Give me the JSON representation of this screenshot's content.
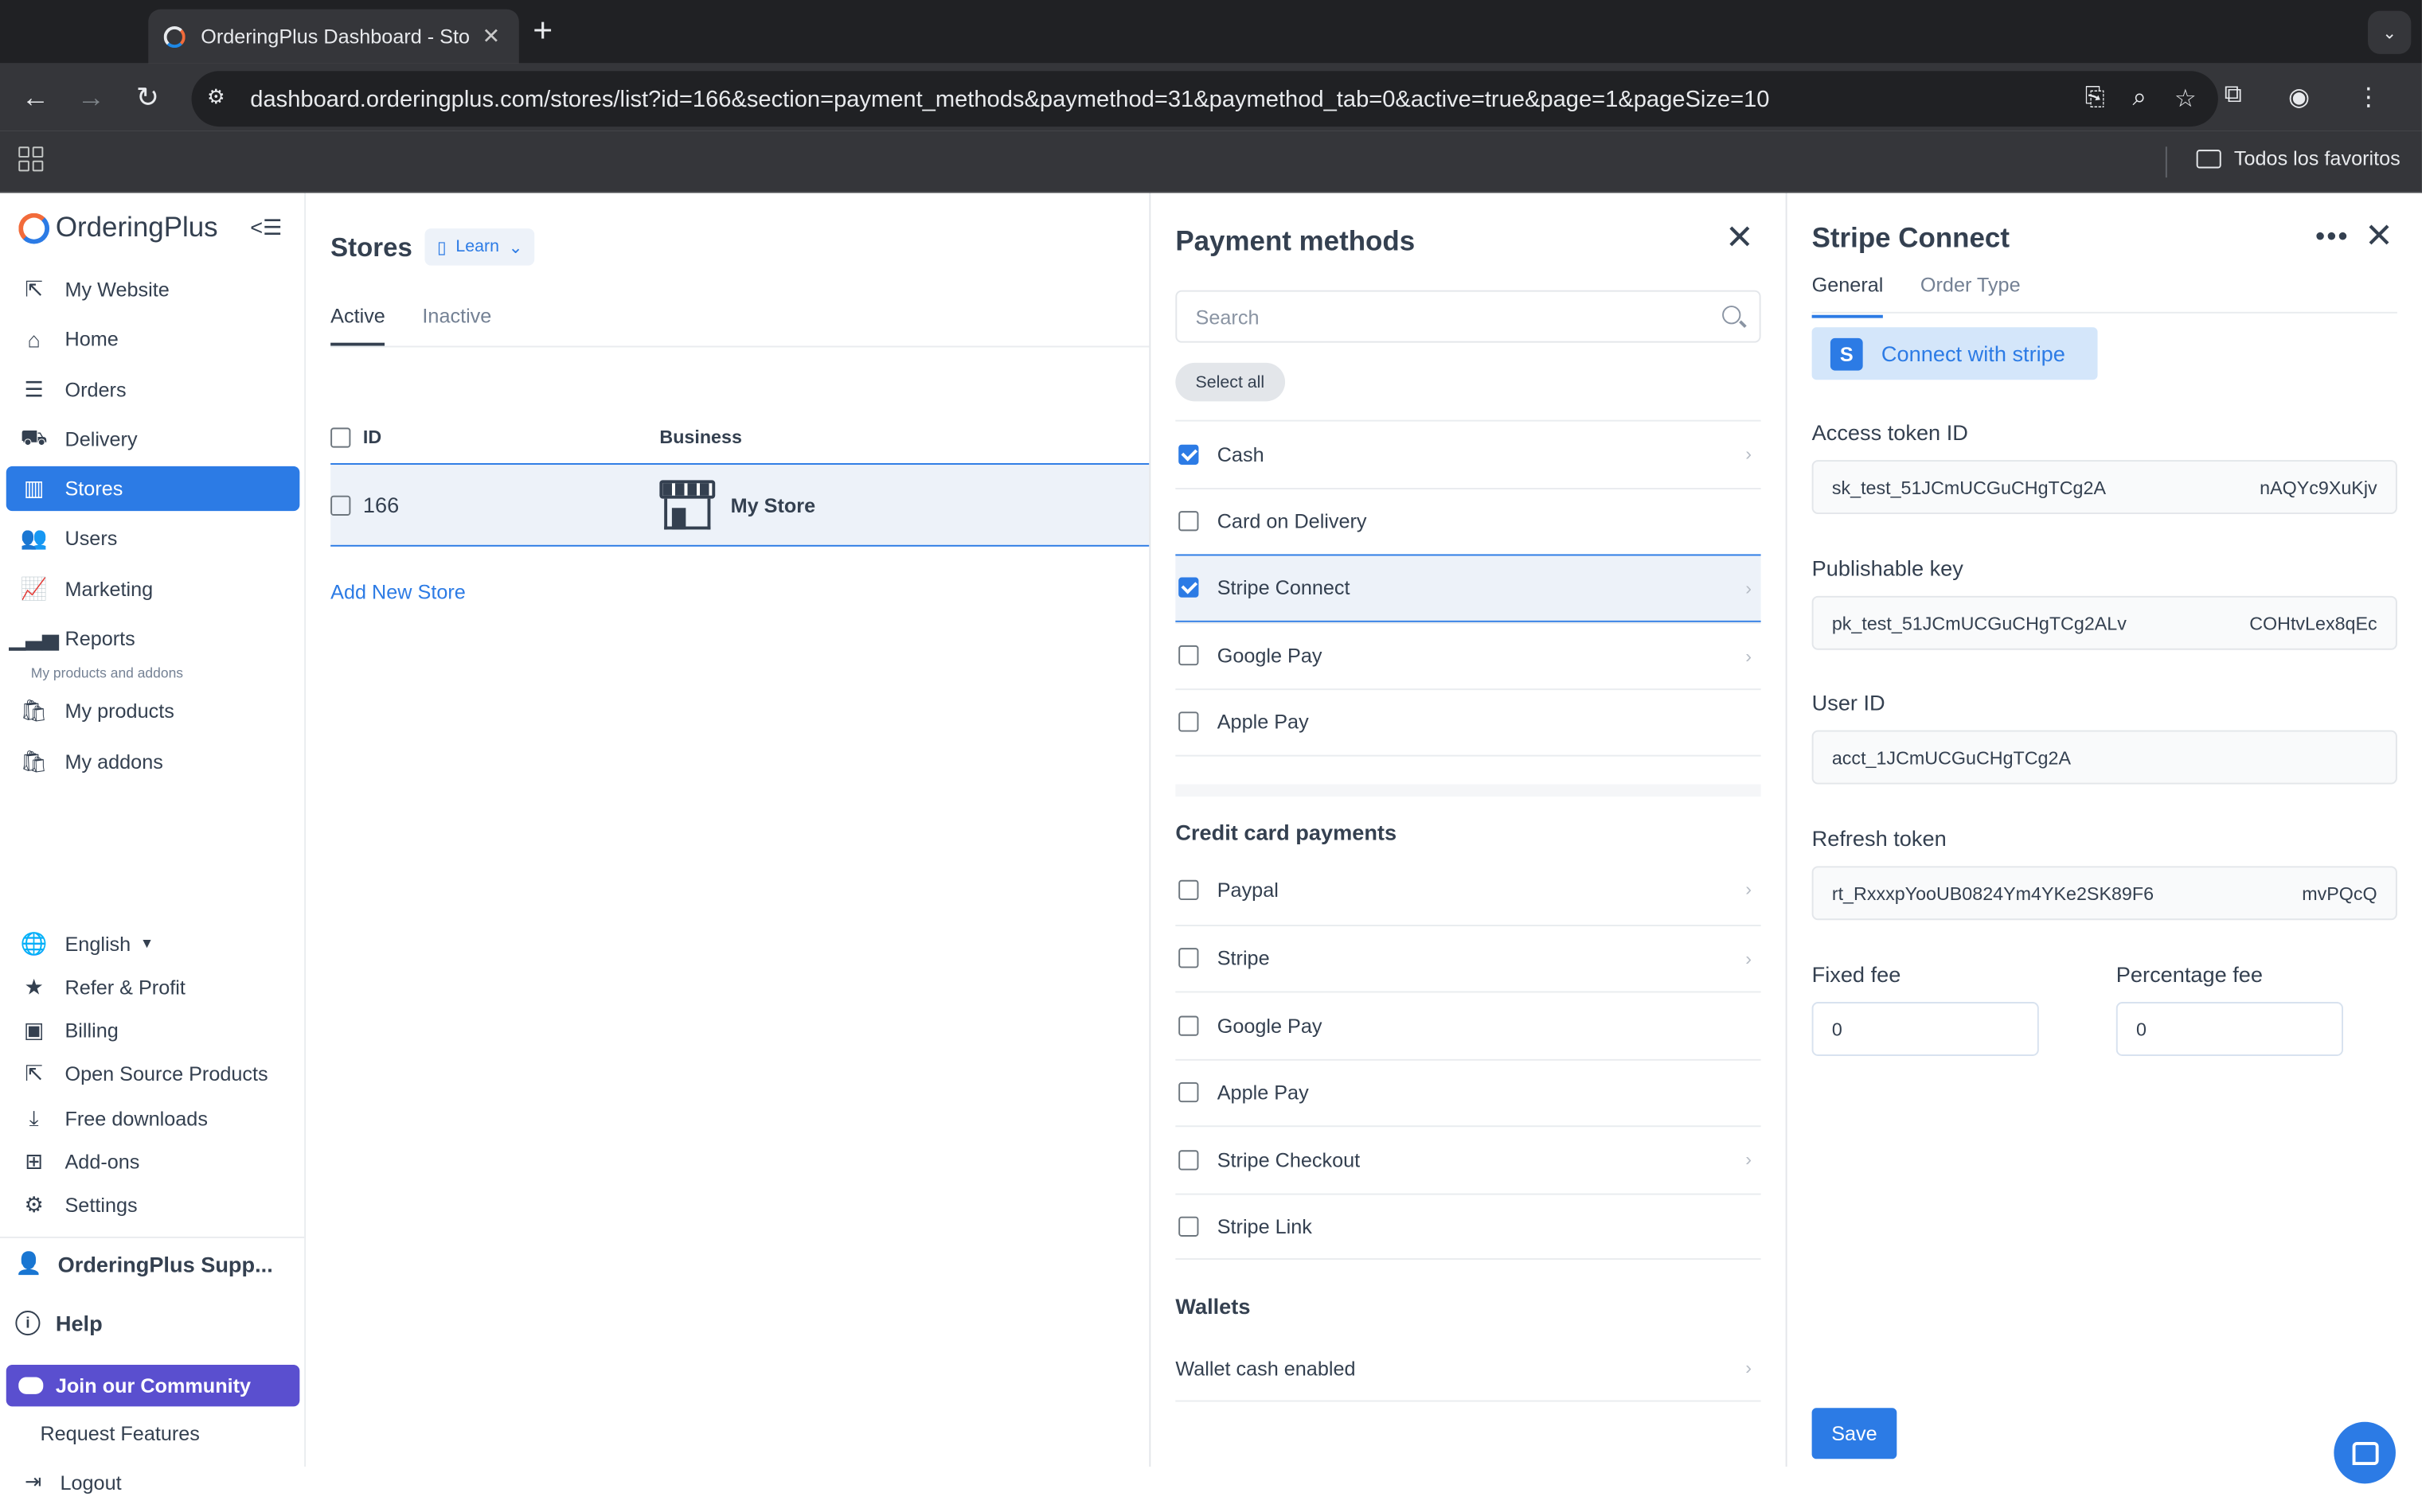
{
  "browser": {
    "tab_title": "OrderingPlus Dashboard - Sto",
    "tab_close": "✕",
    "new_tab": "+",
    "url": "dashboard.orderingplus.com/stores/list?id=166&section=payment_methods&paymethod=31&paymethod_tab=0&active=true&page=1&pageSize=10",
    "bookmarks_all": "Todos los favoritos"
  },
  "sidebar": {
    "brand_main": "Ordering",
    "brand_plus": "Plus",
    "items": [
      {
        "label": "My Website",
        "icon": "external-link-icon"
      },
      {
        "label": "Home",
        "icon": "home-icon"
      },
      {
        "label": "Orders",
        "icon": "list-icon"
      },
      {
        "label": "Delivery",
        "icon": "truck-icon"
      },
      {
        "label": "Stores",
        "icon": "store-icon",
        "active": true
      },
      {
        "label": "Users",
        "icon": "users-icon"
      },
      {
        "label": "Marketing",
        "icon": "chart-line-icon"
      },
      {
        "label": "Reports",
        "icon": "bar-chart-icon"
      }
    ],
    "products_caption": "My products and addons",
    "product_items": [
      {
        "label": "My products",
        "icon": "bag-check-icon"
      },
      {
        "label": "My addons",
        "icon": "bag-heart-icon"
      }
    ],
    "language": "English",
    "bottom_items": [
      {
        "label": "Refer & Profit",
        "icon": "star-icon"
      },
      {
        "label": "Billing",
        "icon": "cash-icon"
      },
      {
        "label": "Open Source Products",
        "icon": "external-link-icon"
      },
      {
        "label": "Free downloads",
        "icon": "download-icon"
      },
      {
        "label": "Add-ons",
        "icon": "bag-plus-icon"
      },
      {
        "label": "Settings",
        "icon": "gear-icon"
      }
    ],
    "support": "OrderingPlus Supp...",
    "help": "Help",
    "community": "Join our Community",
    "request_features": "Request Features",
    "logout": "Logout"
  },
  "stores": {
    "title": "Stores",
    "learn": "Learn",
    "tabs": [
      "Active",
      "Inactive"
    ],
    "columns": {
      "id": "ID",
      "business": "Business"
    },
    "rows": [
      {
        "id": "166",
        "name": "My Store"
      }
    ],
    "add_new": "Add New Store"
  },
  "payment_methods": {
    "title": "Payment methods",
    "search_placeholder": "Search",
    "select_all": "Select all",
    "items": [
      {
        "label": "Cash",
        "checked": true,
        "chevron": true
      },
      {
        "label": "Card on Delivery",
        "checked": false,
        "chevron": false
      },
      {
        "label": "Stripe Connect",
        "checked": true,
        "chevron": true,
        "selected": true
      },
      {
        "label": "Google Pay",
        "checked": false,
        "chevron": true
      },
      {
        "label": "Apple Pay",
        "checked": false,
        "chevron": false
      }
    ],
    "credit_title": "Credit card payments",
    "credit_items": [
      {
        "label": "Paypal",
        "checked": false,
        "chevron": true
      },
      {
        "label": "Stripe",
        "checked": false,
        "chevron": true
      },
      {
        "label": "Google Pay",
        "checked": false,
        "chevron": false
      },
      {
        "label": "Apple Pay",
        "checked": false,
        "chevron": false
      },
      {
        "label": "Stripe Checkout",
        "checked": false,
        "chevron": true
      },
      {
        "label": "Stripe Link",
        "checked": false,
        "chevron": false
      }
    ],
    "wallets_title": "Wallets",
    "wallet_item": "Wallet cash enabled"
  },
  "stripe_connect": {
    "title": "Stripe Connect",
    "tabs": [
      "General",
      "Order Type"
    ],
    "connect_button": "Connect with stripe",
    "access_token_label": "Access token ID",
    "access_token_start": "sk_test_51JCmUCGuCHgTCg2A",
    "access_token_end": "nAQYc9XuKjv",
    "publishable_key_label": "Publishable key",
    "publishable_key_start": "pk_test_51JCmUCGuCHgTCg2ALv",
    "publishable_key_end": "COHtvLex8qEc",
    "user_id_label": "User ID",
    "user_id": "acct_1JCmUCGuCHgTCg2A",
    "refresh_token_label": "Refresh token",
    "refresh_token_start": "rt_RxxxpYooUB0824Ym4YKe2SK89F6",
    "refresh_token_end": "mvPQcQ",
    "fixed_fee_label": "Fixed fee",
    "fixed_fee": "0",
    "percentage_fee_label": "Percentage fee",
    "percentage_fee": "0",
    "save": "Save"
  },
  "colors": {
    "primary": "#2c7be5",
    "community": "#5a4fcf",
    "text": "#344050"
  }
}
